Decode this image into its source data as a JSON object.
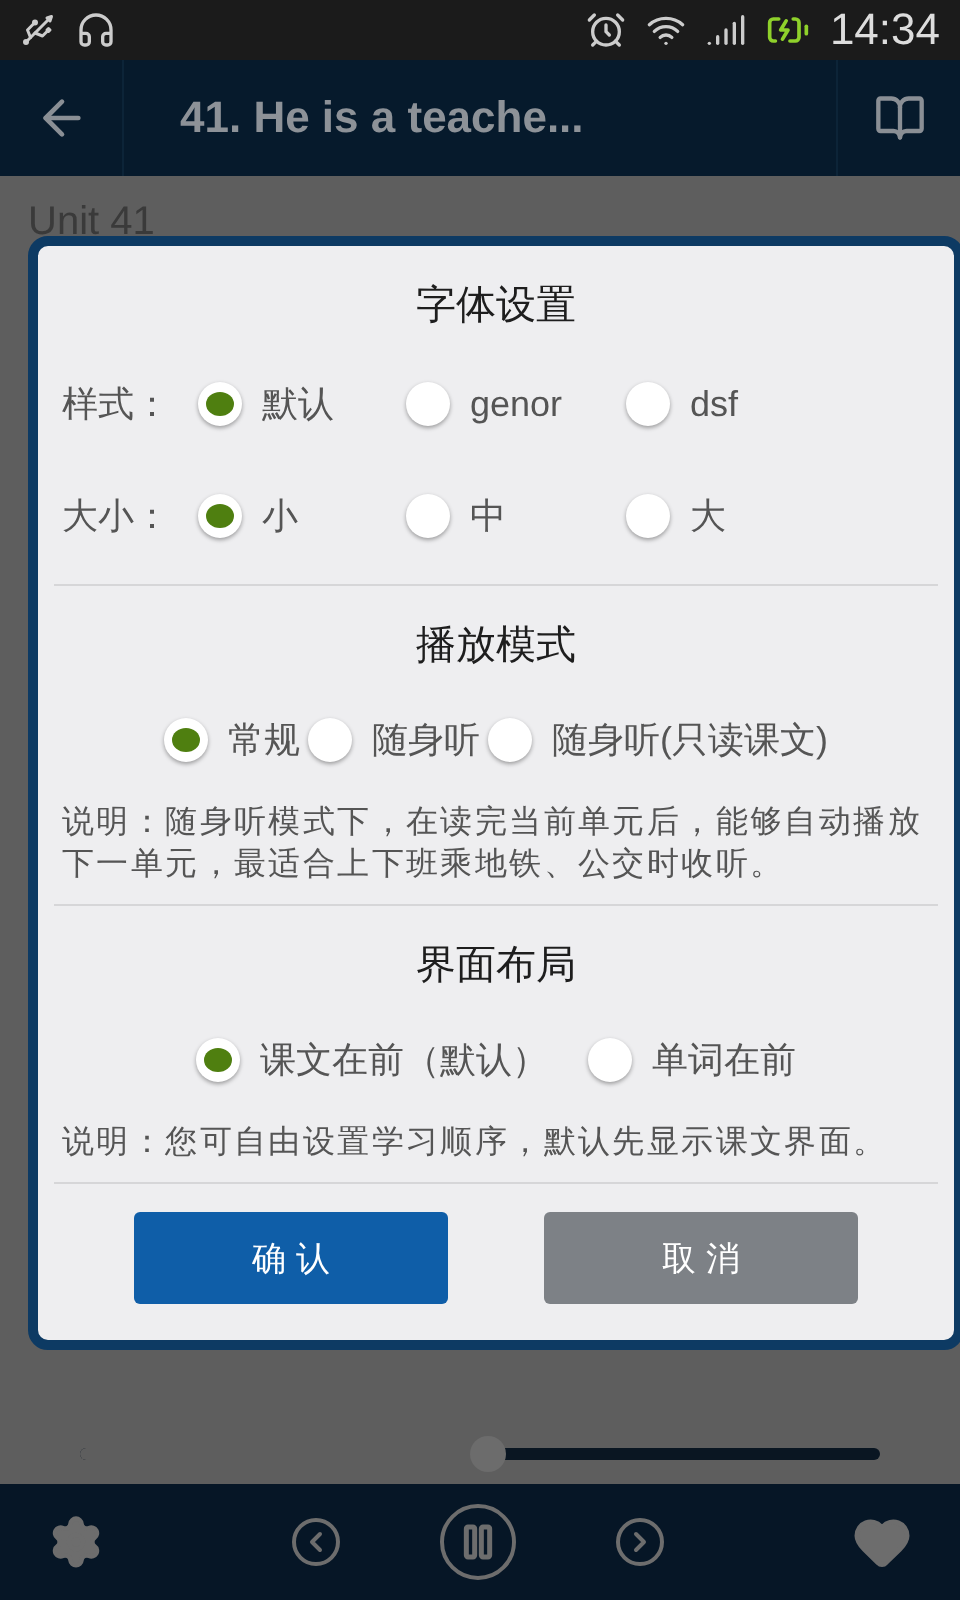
{
  "status_bar": {
    "time": "14:34"
  },
  "app_bar": {
    "title": "41. He is a teache..."
  },
  "content": {
    "heading": "Unit 41"
  },
  "dialog": {
    "font_settings": {
      "title": "字体设置",
      "rows": [
        {
          "label": "样式：",
          "options": [
            {
              "label": "默认",
              "selected": true
            },
            {
              "label": "genor",
              "selected": false
            },
            {
              "label": "dsf",
              "selected": false
            }
          ]
        },
        {
          "label": "大小：",
          "options": [
            {
              "label": "小",
              "selected": true
            },
            {
              "label": "中",
              "selected": false
            },
            {
              "label": "大",
              "selected": false
            }
          ]
        }
      ]
    },
    "play_mode": {
      "title": "播放模式",
      "options": [
        {
          "label": "常规",
          "selected": true
        },
        {
          "label": "随身听",
          "selected": false
        },
        {
          "label": "随身听(只读课文)",
          "selected": false
        }
      ],
      "note": "说明：随身听模式下，在读完当前单元后，能够自动播放下一单元，最适合上下班乘地铁、公交时收听。"
    },
    "layout": {
      "title": "界面布局",
      "options": [
        {
          "label": "课文在前（默认）",
          "selected": true
        },
        {
          "label": "单词在前",
          "selected": false
        }
      ],
      "note": "说明：您可自由设置学习顺序，默认先显示课文界面。"
    },
    "buttons": [
      {
        "label": "确 认",
        "kind": "primary"
      },
      {
        "label": "取 消",
        "kind": "secondary"
      }
    ]
  },
  "player": {
    "seek": {
      "level": 0.51
    }
  }
}
